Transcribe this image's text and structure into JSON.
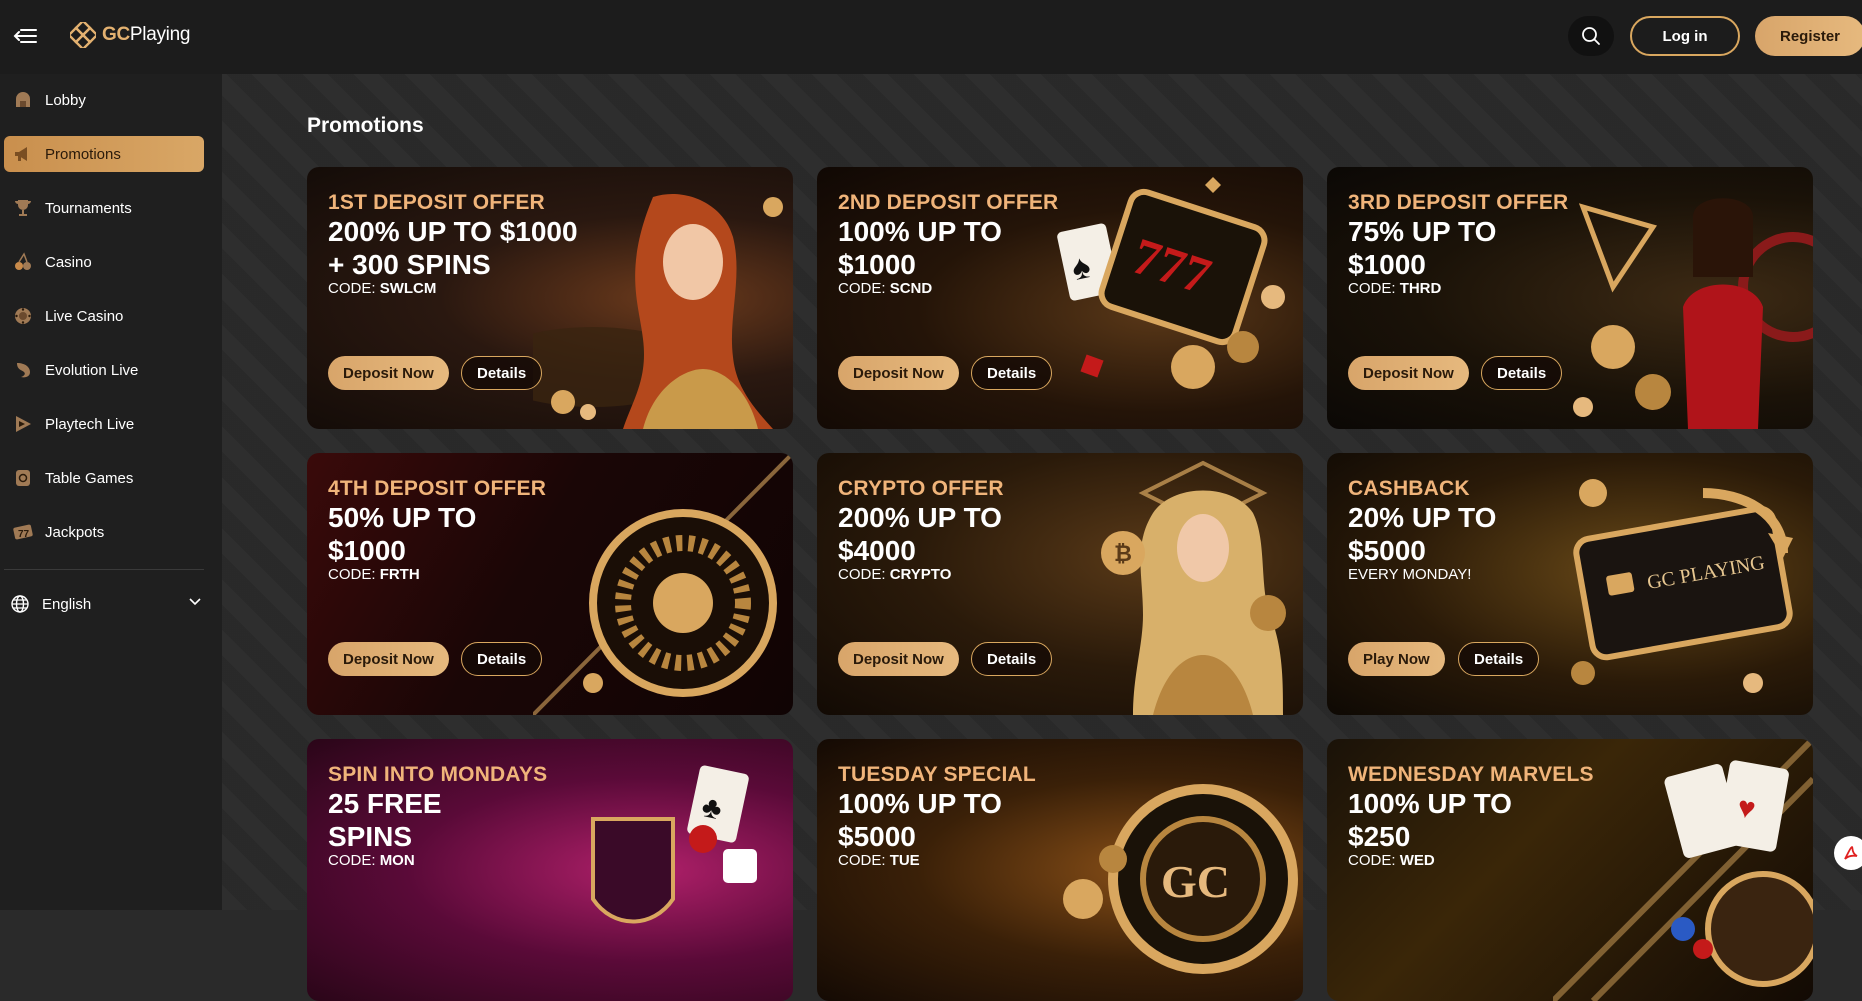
{
  "header": {
    "logo_brand": "GC",
    "logo_word": "Playing",
    "login_label": "Log in",
    "register_label": "Register"
  },
  "sidebar": {
    "items": [
      {
        "label": "Lobby",
        "icon": "lobby-icon"
      },
      {
        "label": "Promotions",
        "icon": "megaphone-icon",
        "active": true
      },
      {
        "label": "Tournaments",
        "icon": "trophy-icon"
      },
      {
        "label": "Casino",
        "icon": "cherries-icon"
      },
      {
        "label": "Live Casino",
        "icon": "roulette-icon"
      },
      {
        "label": "Evolution Live",
        "icon": "evolution-icon"
      },
      {
        "label": "Playtech Live",
        "icon": "play-icon"
      },
      {
        "label": "Table Games",
        "icon": "dice-icon"
      },
      {
        "label": "Jackpots",
        "icon": "slot-seven-icon"
      }
    ],
    "language": "English"
  },
  "main": {
    "title": "Promotions",
    "cards": [
      {
        "eyebrow": "1ST DEPOSIT OFFER",
        "headline": "200% UP TO $1000\n+ 300 SPINS",
        "code_prefix": "CODE: ",
        "code": "SWLCM",
        "primary": "Deposit Now",
        "secondary": "Details"
      },
      {
        "eyebrow": "2ND DEPOSIT OFFER",
        "headline": "100% UP TO\n$1000",
        "code_prefix": "CODE: ",
        "code": "SCND",
        "primary": "Deposit Now",
        "secondary": "Details"
      },
      {
        "eyebrow": "3RD DEPOSIT OFFER",
        "headline": "75% UP TO\n$1000",
        "code_prefix": "CODE: ",
        "code": "THRD",
        "primary": "Deposit Now",
        "secondary": "Details"
      },
      {
        "eyebrow": "4TH DEPOSIT OFFER",
        "headline": "50% UP TO\n$1000",
        "code_prefix": "CODE: ",
        "code": "FRTH",
        "primary": "Deposit Now",
        "secondary": "Details"
      },
      {
        "eyebrow": "CRYPTO OFFER",
        "headline": "200% UP TO\n$4000",
        "code_prefix": "CODE: ",
        "code": "CRYPTO",
        "primary": "Deposit Now",
        "secondary": "Details"
      },
      {
        "eyebrow": "CASHBACK",
        "headline": "20% UP TO\n$5000",
        "code_prefix": "",
        "code": "EVERY MONDAY!",
        "primary": "Play Now",
        "secondary": "Details"
      },
      {
        "eyebrow": "SPIN INTO MONDAYS",
        "headline": "25 FREE\nSPINS",
        "code_prefix": "CODE: ",
        "code": "MON"
      },
      {
        "eyebrow": "TUESDAY SPECIAL",
        "headline": "100% UP TO\n$5000",
        "code_prefix": "CODE: ",
        "code": "TUE"
      },
      {
        "eyebrow": "WEDNESDAY MARVELS",
        "headline": "100% UP TO\n$250",
        "code_prefix": "CODE: ",
        "code": "WED"
      }
    ],
    "cashback_art_text": "GC PLAYING",
    "chip_art_text": "GC"
  }
}
